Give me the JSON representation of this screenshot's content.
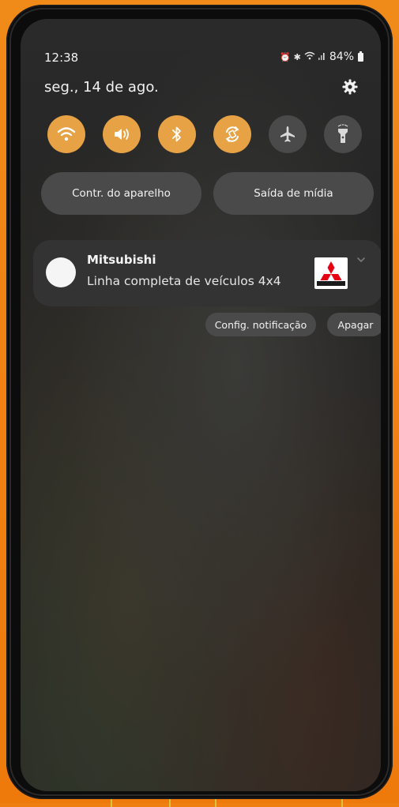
{
  "status_bar": {
    "time": "12:38",
    "battery_percent": "84%",
    "icons": [
      "alarm-icon",
      "bluetooth-icon",
      "wifi-icon",
      "signal-icon",
      "battery-icon"
    ]
  },
  "header": {
    "date": "seg., 14 de ago."
  },
  "quick_toggles": [
    {
      "name": "wifi",
      "icon": "wifi-icon",
      "state": "on"
    },
    {
      "name": "sound",
      "icon": "sound-icon",
      "state": "on"
    },
    {
      "name": "bluetooth",
      "icon": "bluetooth-icon",
      "state": "on"
    },
    {
      "name": "auto-rotate",
      "icon": "auto-rotate-icon",
      "state": "on"
    },
    {
      "name": "airplane-mode",
      "icon": "airplane-icon",
      "state": "off"
    },
    {
      "name": "flashlight",
      "icon": "flashlight-icon",
      "state": "off"
    }
  ],
  "buttons": {
    "device_control": "Contr. do aparelho",
    "media_output": "Saída de mídia"
  },
  "notification": {
    "app_name": "Mitsubishi",
    "text": "Linha completa de veículos 4x4",
    "config_button": "Config. notificação",
    "clear_button": "Apagar"
  },
  "colors": {
    "toggle_on": "#e6a245",
    "toggle_off": "#4a4a4a",
    "backdrop": "#f07f12",
    "brand_red": "#e60012"
  }
}
